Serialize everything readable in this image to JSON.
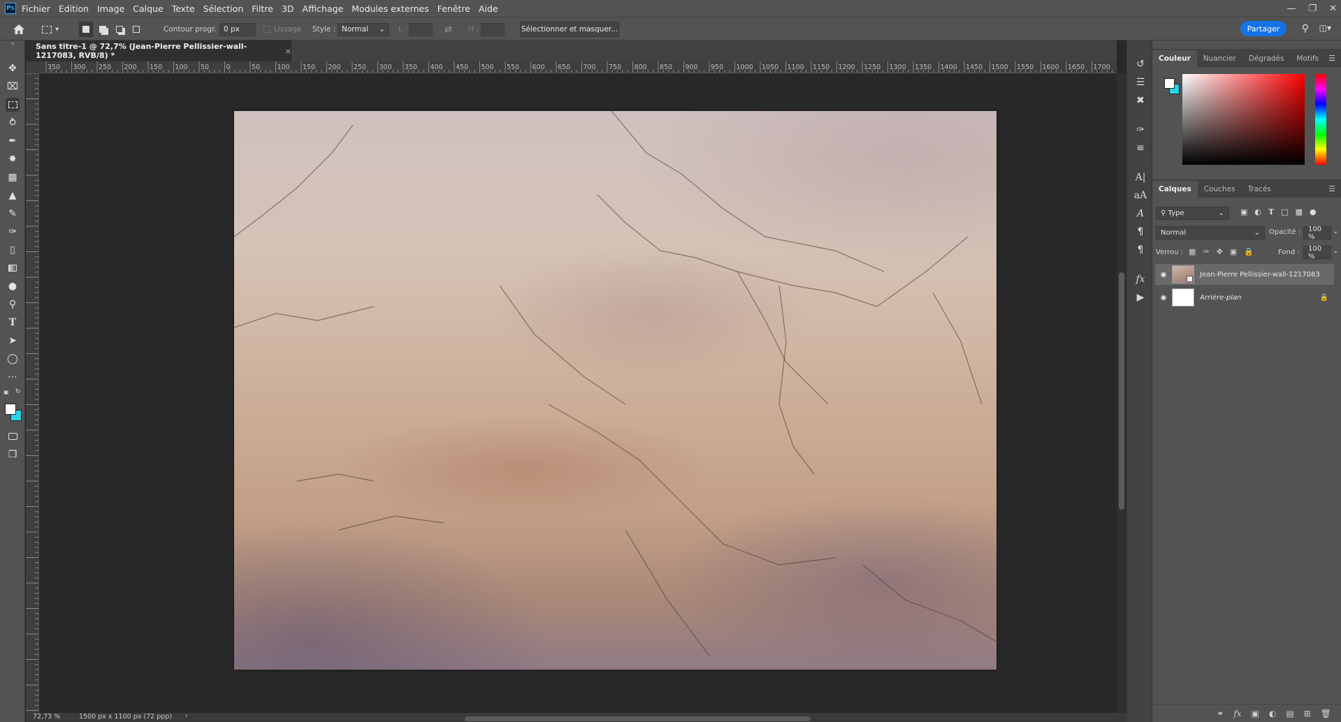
{
  "app": {
    "logo": "Ps"
  },
  "menu": [
    "Fichier",
    "Edition",
    "Image",
    "Calque",
    "Texte",
    "Sélection",
    "Filtre",
    "3D",
    "Affichage",
    "Modules externes",
    "Fenêtre",
    "Aide"
  ],
  "options": {
    "feather_label": "Contour progr. :",
    "feather_value": "0 px",
    "antialias_label": "Lissage",
    "style_label": "Style :",
    "style_value": "Normal",
    "width_label": "L :",
    "height_label": "H :",
    "select_mask_button": "Sélectionner et masquer...",
    "share_button": "Partager"
  },
  "document": {
    "tab_title": "Sans titre-1 @ 72,7% (Jean-Pierre Pellissier-wall-1217083, RVB/8) *",
    "zoom": "72,73 %",
    "doc_info": "1500 px x 1100 px (72 ppp)"
  },
  "ruler": {
    "h_ticks": [
      "350",
      "300",
      "250",
      "200",
      "150",
      "100",
      "50",
      "0",
      "50",
      "100",
      "150",
      "200",
      "250",
      "300",
      "350",
      "400",
      "450",
      "500",
      "550",
      "600",
      "650",
      "700",
      "750",
      "800",
      "850",
      "900",
      "950",
      "1000",
      "1050",
      "1100",
      "1150",
      "1200",
      "1250",
      "1300",
      "1350",
      "1400",
      "1450",
      "1500",
      "1550",
      "1600",
      "1650",
      "1700"
    ]
  },
  "panels": {
    "color_tabs": [
      "Couleur",
      "Nuancier",
      "Dégradés",
      "Motifs"
    ],
    "layer_tabs": [
      "Calques",
      "Couches",
      "Tracés"
    ],
    "filter_kind": "Type",
    "blend_mode": "Normal",
    "opacity_label": "Opacité :",
    "opacity_value": "100 %",
    "lock_label": "Verrou :",
    "fill_label": "Fond :",
    "fill_value": "100 %",
    "layers": [
      {
        "name": "Jean-Pierre Pellissier-wall-1217083",
        "selected": true
      },
      {
        "name": "Arrière-plan",
        "selected": false,
        "locked": true
      }
    ]
  },
  "colors": {
    "foreground": "#ffffff",
    "background": "#29d4e8",
    "accent": "#1473e6"
  }
}
